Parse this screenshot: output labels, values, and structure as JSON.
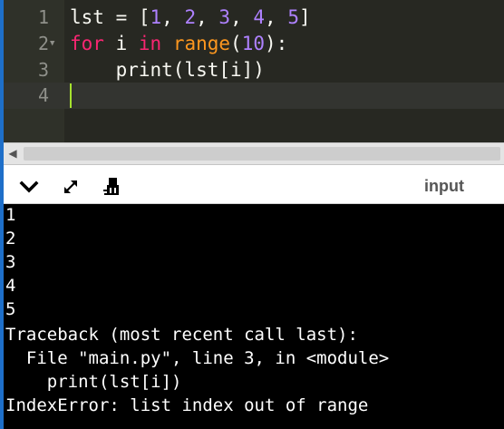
{
  "editor": {
    "lines": [
      {
        "num": "1",
        "tokens": [
          "lst = [",
          "1",
          ", ",
          "2",
          ", ",
          "3",
          ", ",
          "4",
          ", ",
          "5",
          "]"
        ]
      },
      {
        "num": "2",
        "tokens": [
          "for",
          " i ",
          "in",
          " ",
          "range",
          "(",
          "10",
          "):"
        ]
      },
      {
        "num": "3",
        "tokens": [
          "    print(lst[i])"
        ]
      },
      {
        "num": "4",
        "tokens": []
      }
    ],
    "active_line": 4
  },
  "toolbar": {
    "input_label": "input",
    "icons": [
      "chevron-down-icon",
      "expand-icon",
      "clear-console-icon"
    ]
  },
  "console": {
    "lines": [
      "1",
      "2",
      "3",
      "4",
      "5",
      "Traceback (most recent call last):",
      "  File \"main.py\", line 3, in <module>",
      "    print(lst[i])",
      "IndexError: list index out of range"
    ]
  },
  "colors": {
    "editor_bg": "#272822",
    "gutter_bg": "#2f3129",
    "keyword": "#f92672",
    "number": "#ae81ff",
    "builtin": "#fd971f",
    "cursor": "#a6e22e",
    "console_bg": "#000000",
    "console_text": "#ffffff"
  }
}
